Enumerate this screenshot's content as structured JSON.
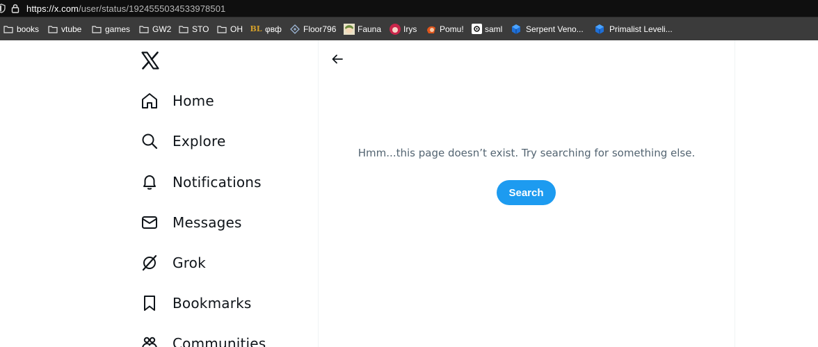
{
  "browser": {
    "url_host": "https://x.com",
    "url_path": "/user/status/1924555034533978501",
    "bookmarks": [
      {
        "label": "books",
        "icon": "folder-icon"
      },
      {
        "label": "vtube",
        "icon": "folder-icon"
      },
      {
        "label": "games",
        "icon": "folder-icon"
      },
      {
        "label": "GW2",
        "icon": "folder-icon"
      },
      {
        "label": "STO",
        "icon": "folder-icon"
      },
      {
        "label": "OH",
        "icon": "folder-icon"
      },
      {
        "label": "φвф",
        "icon": "bl-logo-icon",
        "icon_text": "BL"
      },
      {
        "label": "Floor796",
        "icon": "floor796-icon"
      },
      {
        "label": "Fauna",
        "icon": "fauna-avatar-icon"
      },
      {
        "label": "Irys",
        "icon": "irys-avatar-icon"
      },
      {
        "label": "Pomu!",
        "icon": "pomu-avatar-icon"
      },
      {
        "label": "saml",
        "icon": "saml-icon"
      },
      {
        "label": "Serpent Veno...",
        "icon": "cube-icon"
      },
      {
        "label": "Primalist Leveli...",
        "icon": "cube-icon"
      }
    ]
  },
  "sidebar": {
    "logo": "x-logo-icon",
    "items": [
      {
        "label": "Home",
        "icon": "home-icon"
      },
      {
        "label": "Explore",
        "icon": "search-icon"
      },
      {
        "label": "Notifications",
        "icon": "bell-icon"
      },
      {
        "label": "Messages",
        "icon": "mail-icon"
      },
      {
        "label": "Grok",
        "icon": "grok-icon"
      },
      {
        "label": "Bookmarks",
        "icon": "bookmark-icon"
      },
      {
        "label": "Communities",
        "icon": "communities-icon"
      }
    ]
  },
  "main": {
    "back_icon": "back-arrow-icon",
    "message": "Hmm...this page doesn’t exist. Try searching for something else.",
    "search_button": "Search"
  },
  "colors": {
    "accent": "#1d9bf0",
    "text_primary": "#0f1419",
    "text_secondary": "#536471",
    "bookmarks_bar": "#3b3b3b",
    "address_bar": "#0f0f0f"
  }
}
